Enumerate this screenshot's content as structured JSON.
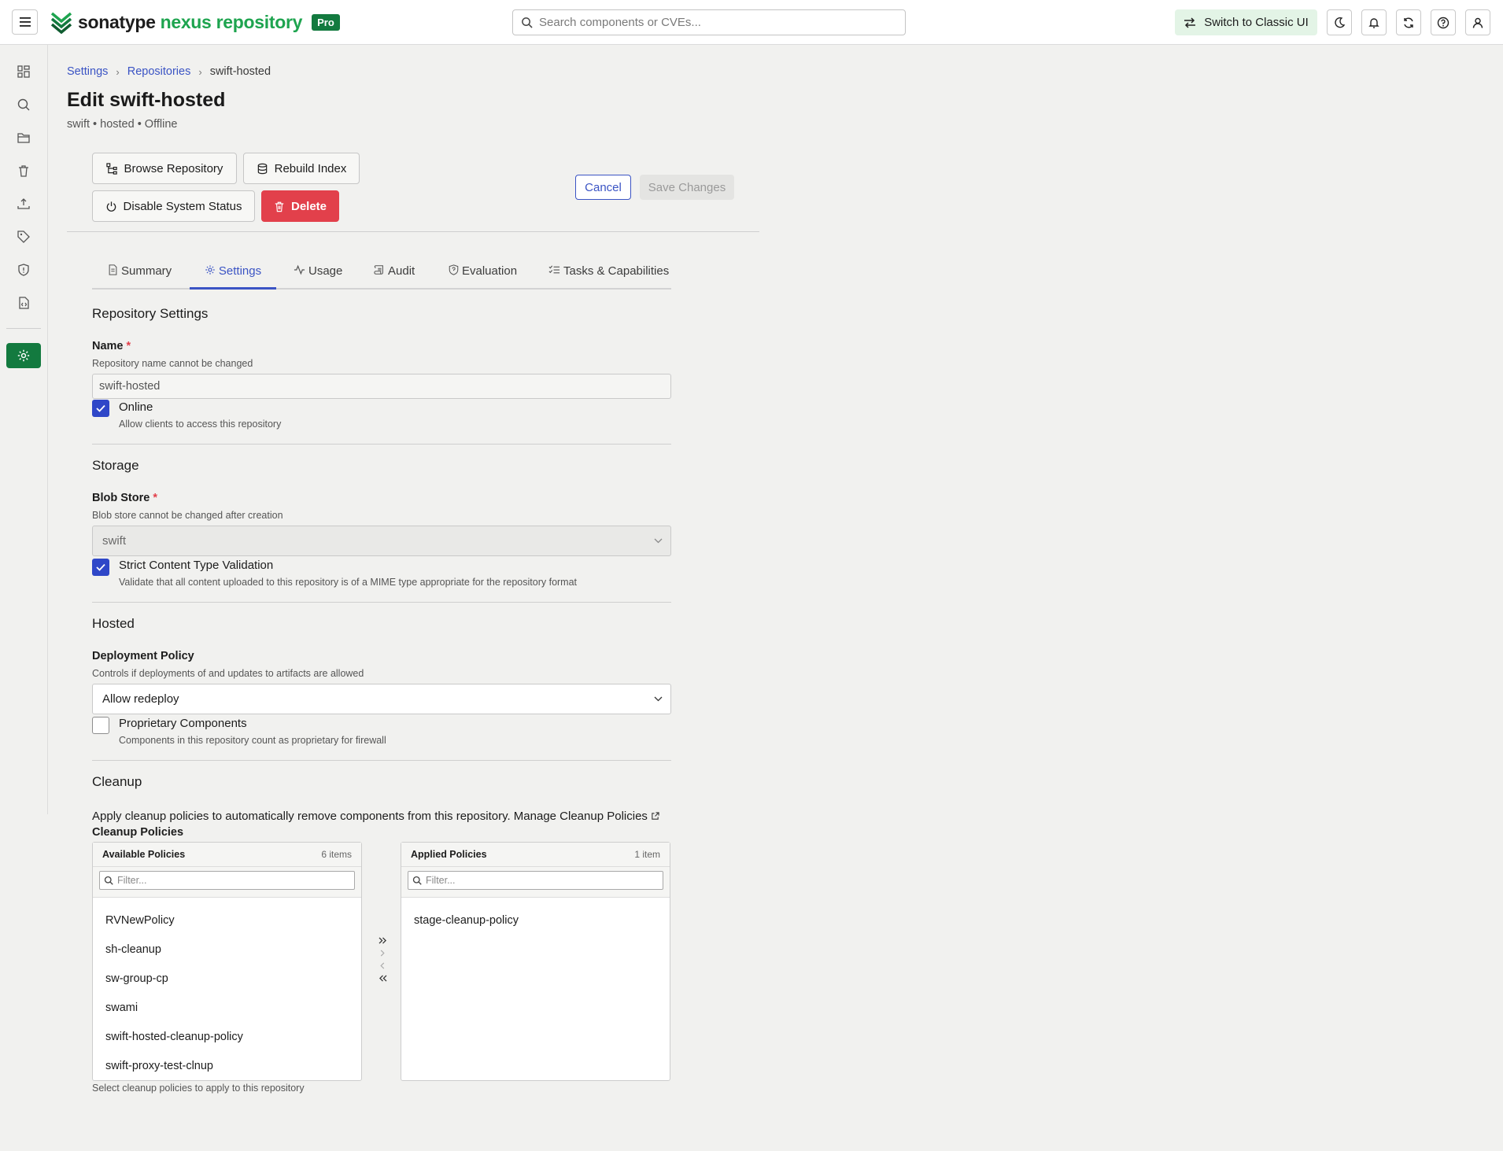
{
  "app": {
    "brand_part1": "sonatype",
    "brand_part2": "nexus repository",
    "edition_badge": "Pro",
    "brand_color": "#1ea44f",
    "accent_color": "#3b54c4"
  },
  "topbar": {
    "search_placeholder": "Search components or CVEs...",
    "classic_ui_label": "Switch to Classic UI",
    "icons": [
      "moon-icon",
      "bell-icon",
      "refresh-icon",
      "help-icon",
      "user-icon"
    ]
  },
  "rail": {
    "icons": [
      "dashboard-icon",
      "search-icon",
      "folder-icon",
      "trash-icon",
      "upload-icon",
      "tag-icon",
      "shield-icon",
      "file-code-icon",
      "settings-icon"
    ],
    "active": "settings-icon"
  },
  "breadcrumb": {
    "items": [
      "Settings",
      "Repositories",
      "swift-hosted"
    ]
  },
  "page": {
    "title": "Edit swift-hosted",
    "subtitle": "swift • hosted • Offline"
  },
  "actions": {
    "browse": "Browse Repository",
    "rebuild": "Rebuild Index",
    "disable": "Disable System Status",
    "delete": "Delete",
    "cancel": "Cancel",
    "save": "Save Changes"
  },
  "tabs": [
    {
      "label": "Summary",
      "icon": "document-icon",
      "active": false
    },
    {
      "label": "Settings",
      "icon": "gear-icon",
      "active": true
    },
    {
      "label": "Usage",
      "icon": "activity-icon",
      "active": false
    },
    {
      "label": "Audit",
      "icon": "scroll-icon",
      "active": false
    },
    {
      "label": "Evaluation",
      "icon": "shield-question-icon",
      "active": false
    },
    {
      "label": "Tasks & Capabilities",
      "icon": "checklist-icon",
      "active": false
    }
  ],
  "repository_settings": {
    "title": "Repository Settings",
    "name_label": "Name",
    "name_required": "*",
    "name_help": "Repository name cannot be changed",
    "name_value": "swift-hosted",
    "online_label": "Online",
    "online_help": "Allow clients to access this repository",
    "online_checked": true
  },
  "storage": {
    "title": "Storage",
    "blob_label": "Blob Store",
    "blob_required": "*",
    "blob_help": "Blob store cannot be changed after creation",
    "blob_value": "swift",
    "strict_label": "Strict Content Type Validation",
    "strict_help": "Validate that all content uploaded to this repository is of a MIME type appropriate for the repository format",
    "strict_checked": true
  },
  "hosted": {
    "title": "Hosted",
    "deploy_label": "Deployment Policy",
    "deploy_help": "Controls if deployments of and updates to artifacts are allowed",
    "deploy_value": "Allow redeploy",
    "proprietary_label": "Proprietary Components",
    "proprietary_help": "Components in this repository count as proprietary for firewall",
    "proprietary_checked": false
  },
  "cleanup": {
    "title": "Cleanup",
    "description": "Apply cleanup policies to automatically remove components from this repository. Manage Cleanup Policies",
    "policies_label": "Cleanup Policies",
    "available": {
      "title": "Available Policies",
      "count": "6 items",
      "filter_placeholder": "Filter...",
      "items": [
        "RVNewPolicy",
        "sh-cleanup",
        "sw-group-cp",
        "swami",
        "swift-hosted-cleanup-policy",
        "swift-proxy-test-clnup"
      ]
    },
    "applied": {
      "title": "Applied Policies",
      "count": "1 item",
      "filter_placeholder": "Filter...",
      "items": [
        "stage-cleanup-policy"
      ]
    },
    "help": "Select cleanup policies to apply to this repository"
  }
}
